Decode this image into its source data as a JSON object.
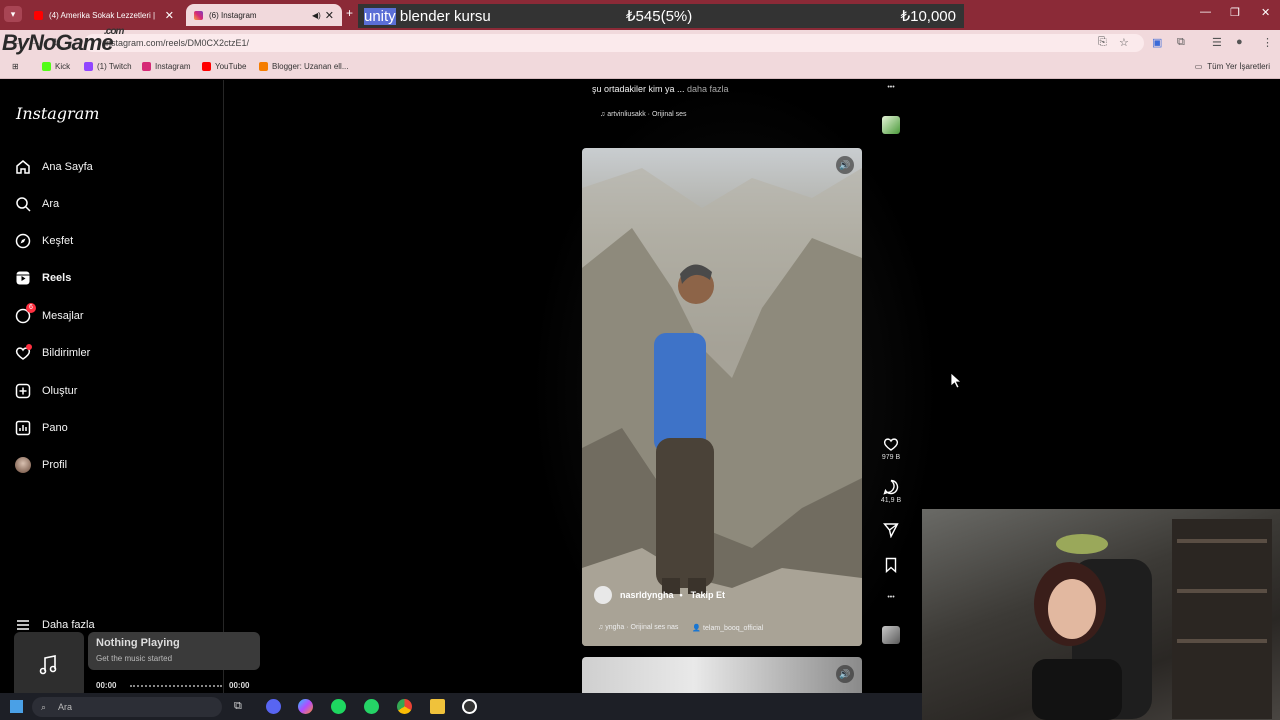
{
  "browser": {
    "tabs": [
      {
        "label": "(4) Amerika Sokak Lezzetleri |",
        "active": false
      },
      {
        "label": "(6) Instagram",
        "active": true
      }
    ],
    "url": "instagram.com/reels/DM0CX2ctzE1/",
    "bookmarks": [
      "Kick",
      "(1) Twitch",
      "Instagram",
      "YouTube",
      "Blogger: Uzanan ell..."
    ],
    "all_bookmarks_label": "Tüm Yer İşaretleri"
  },
  "overlay": {
    "watermark": "ByNoGame",
    "watermark_suffix": ".com",
    "ticker_highlight": "unity",
    "ticker_title": " blender kursu",
    "ticker_amount": "₺545(5%)",
    "ticker_goal": "₺10,000"
  },
  "sidebar": {
    "logo": "Instagram",
    "items": [
      {
        "label": "Ana Sayfa"
      },
      {
        "label": "Ara"
      },
      {
        "label": "Keşfet"
      },
      {
        "label": "Reels"
      },
      {
        "label": "Mesajlar",
        "badge": "6"
      },
      {
        "label": "Bildirimler"
      },
      {
        "label": "Oluştur"
      },
      {
        "label": "Pano"
      },
      {
        "label": "Profil"
      }
    ],
    "more": "Daha fazla"
  },
  "reel": {
    "caption": "şu ortadakiler kim ya ...",
    "caption_more": " daha fazla",
    "prev_audio": "artvinliusakk · Orijinal ses",
    "username": "nasrldyngha",
    "separator": "•",
    "follow": "Takip Et",
    "audio": "yngha · Orijinal ses",
    "audio_extra": "nas",
    "tagged": "telam_booq_official",
    "likes": "979 B",
    "comments": "41,9 B"
  },
  "media_player": {
    "title": "Nothing Playing",
    "subtitle": "Get the music started",
    "time_start": "00:00",
    "time_end": "00:00"
  },
  "taskbar": {
    "search_label": "Ara"
  },
  "colors": {
    "tab_bar": "#8b2a37",
    "address_bar": "#f1d9dc",
    "background": "#000000",
    "badge": "#ff3040"
  }
}
